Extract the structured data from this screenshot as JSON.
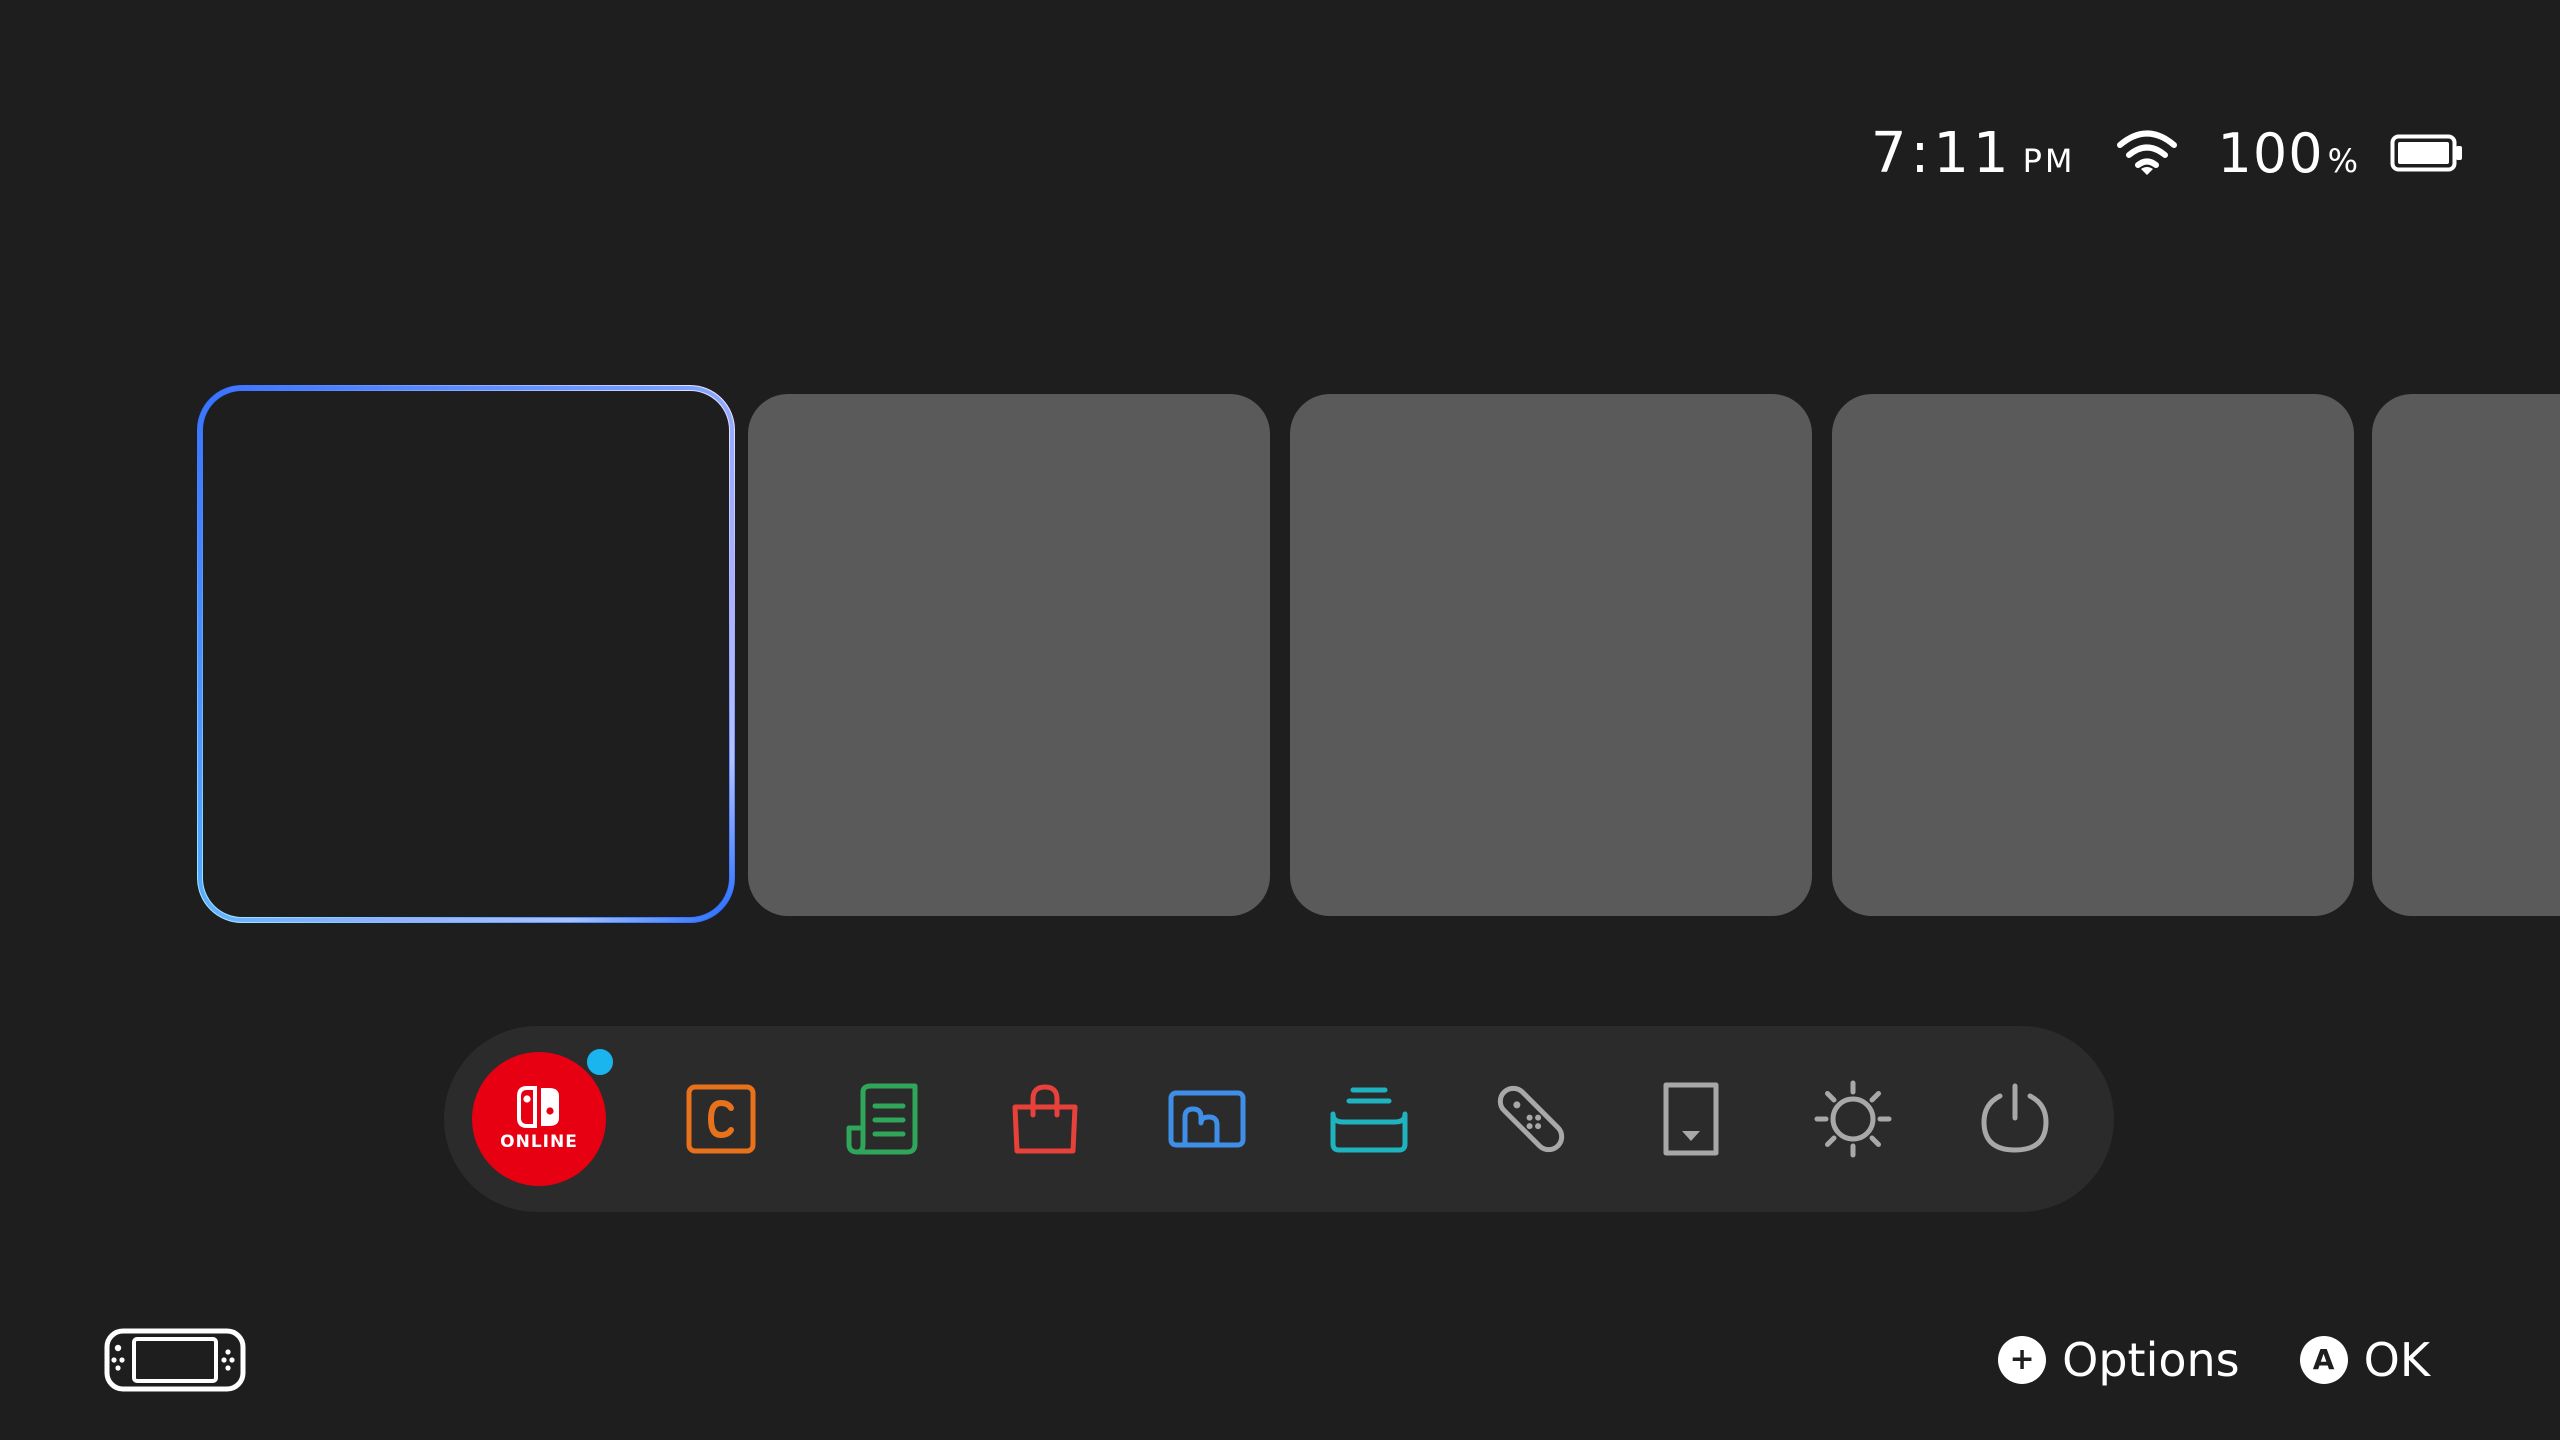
{
  "status_bar": {
    "time": "7:11",
    "ampm": "PM",
    "wifi_icon": "wifi-icon",
    "battery_percent_value": "100",
    "battery_percent_symbol": "%",
    "battery_level": 1.0,
    "battery_icon": "battery-full-icon"
  },
  "tiles": {
    "count_visible": 5,
    "selected_index": 0,
    "selected_frame_colors": [
      "#4a7bff",
      "#1f6fff",
      "#b7a8ff",
      "#f0e6ff",
      "#9ff3ff"
    ],
    "tile_color": "#5a5a5a"
  },
  "dock": {
    "items": [
      {
        "name": "nintendo-switch-online",
        "label": "ONLINE",
        "icon": "switch-online-icon",
        "color": "#e60012",
        "has_notification": true,
        "notification_color": "#1ab4ee"
      },
      {
        "name": "news",
        "icon": "news-c-icon",
        "color": "#e8711b"
      },
      {
        "name": "catalog",
        "icon": "scroll-list-icon",
        "color": "#2fa65a"
      },
      {
        "name": "eshop",
        "icon": "shopping-bag-icon",
        "color": "#e8413a"
      },
      {
        "name": "album",
        "icon": "album-icon",
        "color": "#3f8fe8"
      },
      {
        "name": "chat",
        "icon": "chat-stack-icon",
        "color": "#1fb3bf"
      },
      {
        "name": "controllers",
        "icon": "joycon-icon",
        "color": "#a8a8a8"
      },
      {
        "name": "virtual-game-cards",
        "icon": "game-card-icon",
        "color": "#a8a8a8"
      },
      {
        "name": "system-settings",
        "icon": "sun-gear-icon",
        "color": "#a8a8a8"
      },
      {
        "name": "power",
        "icon": "power-icon",
        "color": "#a8a8a8"
      }
    ]
  },
  "footer": {
    "console_icon": "handheld-console-icon",
    "options_button": "+",
    "options_label": "Options",
    "ok_button": "A",
    "ok_label": "OK"
  }
}
